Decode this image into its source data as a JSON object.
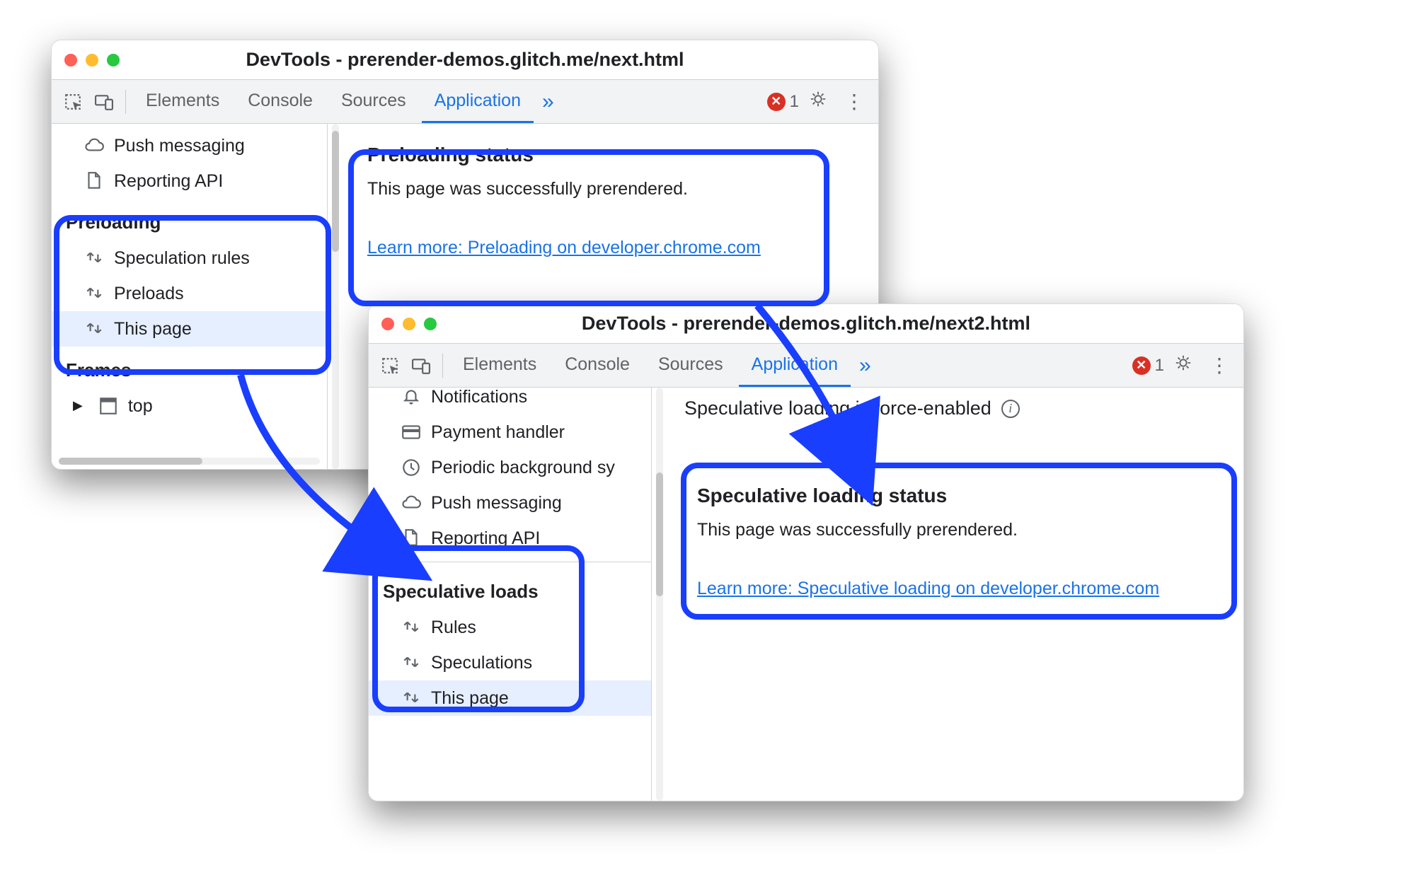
{
  "win1": {
    "title": "DevTools - prerender-demos.glitch.me/next.html",
    "tabs": {
      "elements": "Elements",
      "console": "Console",
      "sources": "Sources",
      "application": "Application"
    },
    "error_count": "1",
    "sidebar": {
      "push_messaging": "Push messaging",
      "reporting_api": "Reporting API",
      "preloading_header": "Preloading",
      "speculation_rules": "Speculation rules",
      "preloads": "Preloads",
      "this_page": "This page",
      "frames_header": "Frames",
      "top_item": "top"
    },
    "panel": {
      "heading": "Preloading status",
      "message": "This page was successfully prerendered.",
      "link": "Learn more: Preloading on developer.chrome.com"
    }
  },
  "win2": {
    "title": "DevTools - prerender-demos.glitch.me/next2.html",
    "tabs": {
      "elements": "Elements",
      "console": "Console",
      "sources": "Sources",
      "application": "Application"
    },
    "error_count": "1",
    "banner": "Speculative loading is force-enabled",
    "sidebar": {
      "notifications": "Notifications",
      "payment_handler": "Payment handler",
      "periodic_bg_sync": "Periodic background sy",
      "push_messaging": "Push messaging",
      "reporting_api": "Reporting API",
      "section_header": "Speculative loads",
      "rules": "Rules",
      "speculations": "Speculations",
      "this_page": "This page"
    },
    "panel": {
      "heading": "Speculative loading status",
      "message": "This page was successfully prerendered.",
      "link": "Learn more: Speculative loading on developer.chrome.com"
    }
  }
}
